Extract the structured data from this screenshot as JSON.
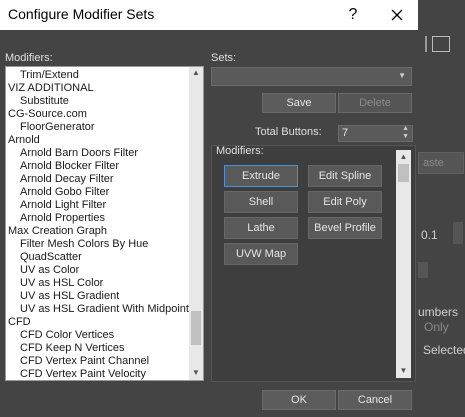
{
  "window": {
    "title": "Configure Modifier Sets",
    "help_label": "?",
    "close_label": "✕"
  },
  "modifiers_list": {
    "label": "Modifiers:",
    "items": [
      {
        "text": "Trim/Extend",
        "indent": true
      },
      {
        "text": "VIZ ADDITIONAL",
        "indent": false
      },
      {
        "text": "Substitute",
        "indent": true
      },
      {
        "text": "CG-Source.com",
        "indent": false
      },
      {
        "text": "FloorGenerator",
        "indent": true
      },
      {
        "text": "Arnold",
        "indent": false
      },
      {
        "text": "Arnold Barn Doors Filter",
        "indent": true
      },
      {
        "text": "Arnold Blocker Filter",
        "indent": true
      },
      {
        "text": "Arnold Decay Filter",
        "indent": true
      },
      {
        "text": "Arnold Gobo Filter",
        "indent": true
      },
      {
        "text": "Arnold Light Filter",
        "indent": true
      },
      {
        "text": "Arnold Properties",
        "indent": true
      },
      {
        "text": "Max Creation Graph",
        "indent": false
      },
      {
        "text": "Filter Mesh Colors By Hue",
        "indent": true
      },
      {
        "text": "QuadScatter",
        "indent": true
      },
      {
        "text": "UV as Color",
        "indent": true
      },
      {
        "text": "UV as HSL Color",
        "indent": true
      },
      {
        "text": "UV as HSL Gradient",
        "indent": true
      },
      {
        "text": "UV as HSL Gradient With Midpoint",
        "indent": true
      },
      {
        "text": "CFD",
        "indent": false
      },
      {
        "text": "CFD Color Vertices",
        "indent": true
      },
      {
        "text": "CFD Keep N Vertices",
        "indent": true
      },
      {
        "text": "CFD Vertex Paint Channel",
        "indent": true
      },
      {
        "text": "CFD Vertex Paint Velocity",
        "indent": true
      }
    ]
  },
  "sets": {
    "label": "Sets:",
    "combo_value": "",
    "save_label": "Save",
    "delete_label": "Delete",
    "total_buttons_label": "Total Buttons:",
    "total_buttons_value": "7"
  },
  "modifiers_group": {
    "label": "Modifiers:",
    "buttons": [
      "Extrude",
      "Edit Spline",
      "Shell",
      "Edit Poly",
      "Lathe",
      "Bevel Profile",
      "UVW Map"
    ],
    "selected": "Extrude"
  },
  "footer": {
    "ok_label": "OK",
    "cancel_label": "Cancel"
  },
  "background_app": {
    "paste_fragment": "aste",
    "value_fragment": "0.1",
    "numbers_fragment": "umbers",
    "only_fragment": "Only",
    "selected_fragment": "Selected"
  },
  "colors": {
    "dialog_bg": "#444444",
    "selection_border": "#4d8fd6"
  }
}
